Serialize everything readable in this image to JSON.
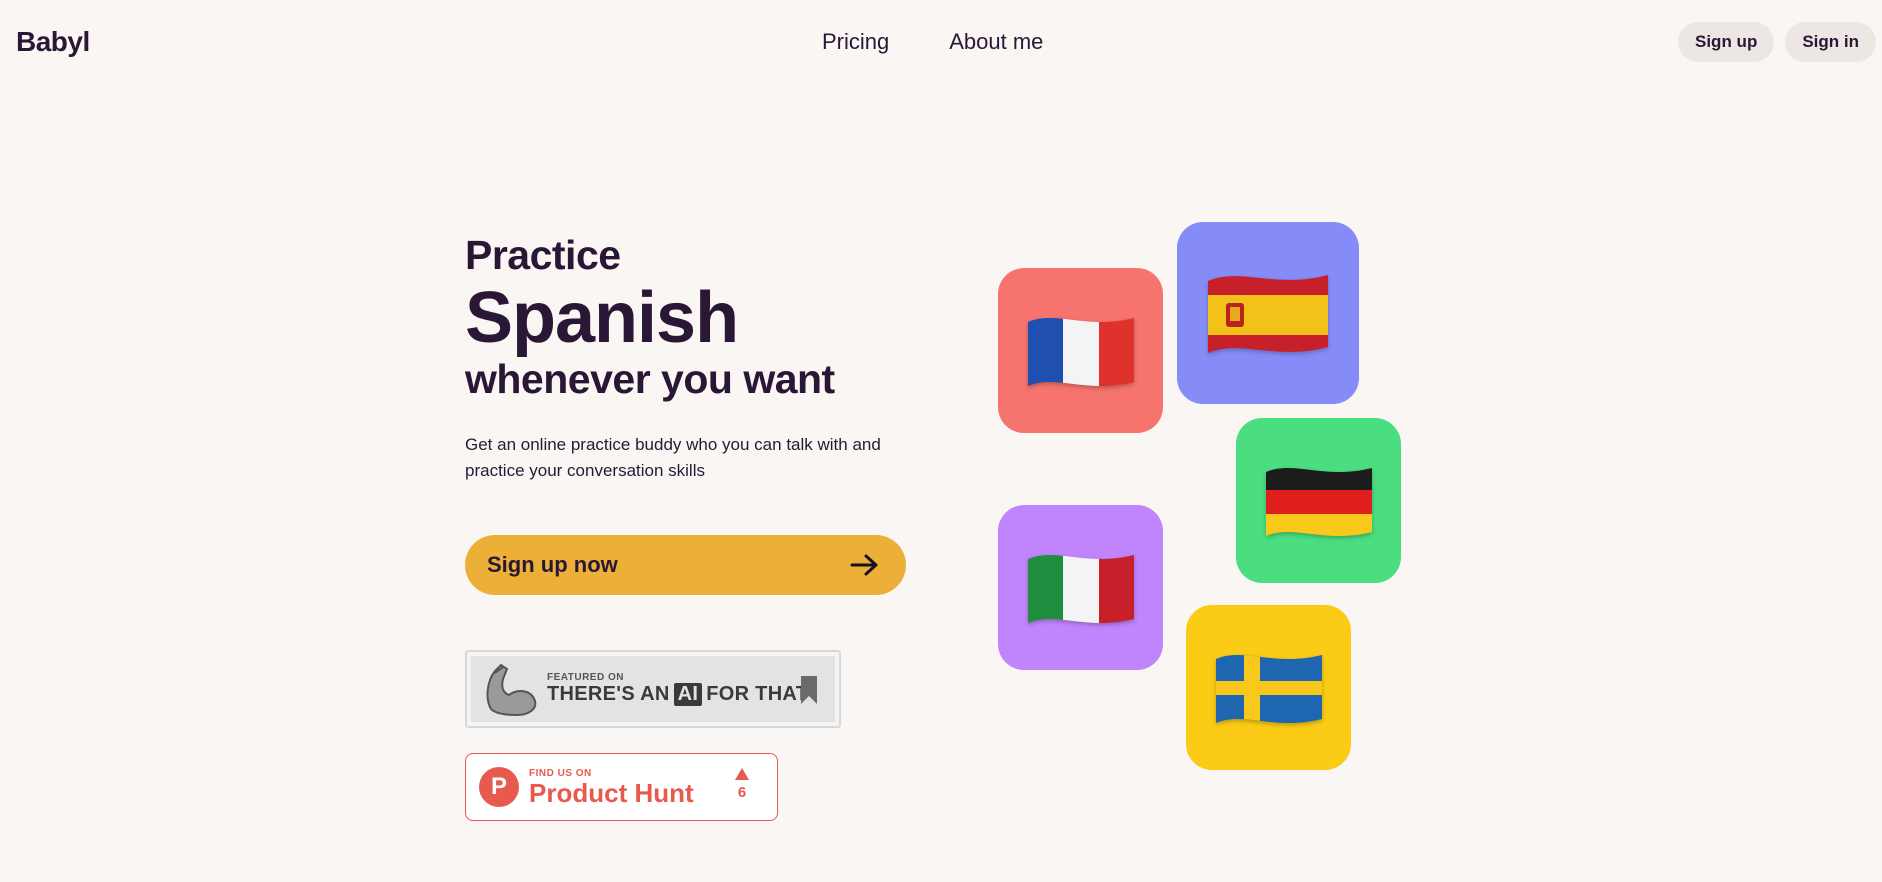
{
  "header": {
    "logo": "Babyl",
    "nav": [
      {
        "label": "Pricing"
      },
      {
        "label": "About me"
      }
    ],
    "sign_up": "Sign up",
    "sign_in": "Sign in"
  },
  "hero": {
    "line1": "Practice",
    "language": "Spanish",
    "line3": "whenever you want",
    "subtitle": "Get an online practice buddy who you can talk with and practice your conversation skills",
    "cta": "Sign up now"
  },
  "badges": {
    "aift": {
      "small": "FEATURED ON",
      "big_pre": "THERE'S AN",
      "big_ai": "AI",
      "big_post": "FOR THAT"
    },
    "product_hunt": {
      "logo_letter": "P",
      "small": "FIND US ON",
      "big": "Product Hunt",
      "votes": "6"
    }
  },
  "flags": [
    {
      "country": "France",
      "icon": "france-flag-icon",
      "tile_color": "#f6736e"
    },
    {
      "country": "Spain",
      "icon": "spain-flag-icon",
      "tile_color": "#868cf7"
    },
    {
      "country": "Germany",
      "icon": "germany-flag-icon",
      "tile_color": "#4ade80"
    },
    {
      "country": "Italy",
      "icon": "italy-flag-icon",
      "tile_color": "#c084fc"
    },
    {
      "country": "Sweden",
      "icon": "sweden-flag-icon",
      "tile_color": "#facc15"
    }
  ],
  "colors": {
    "background": "#faf6f3",
    "text": "#2a1736",
    "cta": "#ecb039",
    "product_hunt": "#e8594e"
  }
}
